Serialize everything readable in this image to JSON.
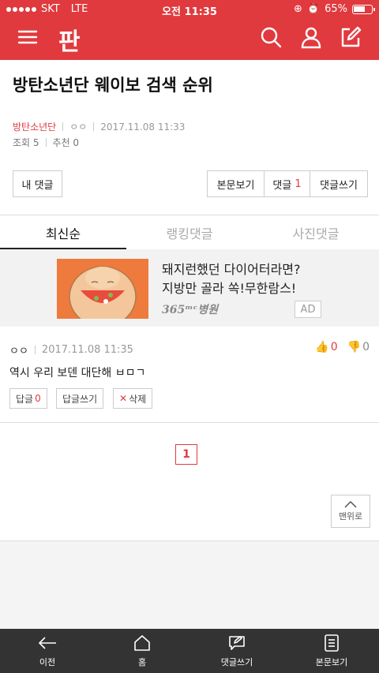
{
  "status": {
    "carrier": "SKT",
    "network": "LTE",
    "time": "오전 11:35",
    "battery": "65%"
  },
  "header": {
    "logo": "판"
  },
  "post": {
    "title": "방탄소년단 웨이보 검색 순위",
    "category": "방탄소년단",
    "author": "ㅇㅇ",
    "datetime": "2017.11.08 11:33",
    "views_label": "조회 5",
    "recommend_label": "추천 0"
  },
  "actions": {
    "my_comments": "내 댓글",
    "view_body": "본문보기",
    "comments_label": "댓글",
    "comments_count": "1",
    "write_comment": "댓글쓰기"
  },
  "tabs": [
    "최신순",
    "랭킹댓글",
    "사진댓글"
  ],
  "ad": {
    "line1": "돼지런했던 다이어터라면?",
    "line2": "지방만 골라 쏙!무한람스!",
    "brand": "365ᵐᶜ병원",
    "badge": "AD"
  },
  "comment": {
    "author": "ㅇㅇ",
    "datetime": "2017.11.08 11:35",
    "likes": "0",
    "dislikes": "0",
    "text": "역시 우리 보덴 대단해 ㅂㅁㄱ",
    "reply_label": "답글",
    "reply_count": "0",
    "write_reply": "답글쓰기",
    "delete": "삭제"
  },
  "pagination": {
    "current": "1"
  },
  "to_top": "맨위로",
  "bottom_nav": {
    "back": "이전",
    "home": "홈",
    "write_comment": "댓글쓰기",
    "view_body": "본문보기"
  },
  "colors": {
    "accent": "#e03a3e",
    "nav_bg": "#333333"
  }
}
